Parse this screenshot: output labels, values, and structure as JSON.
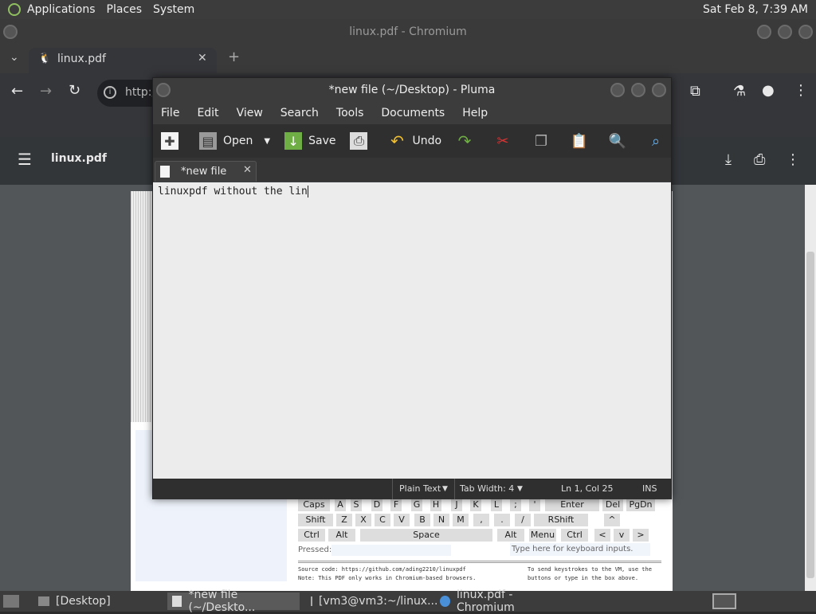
{
  "top_panel": {
    "menus": [
      "Applications",
      "Places",
      "System"
    ],
    "clock": "Sat Feb  8,  7:39 AM"
  },
  "chromium": {
    "window_title": "linux.pdf - Chromium",
    "tab_title": "linux.pdf",
    "address": "http:/",
    "pdf_title": "linux.pdf"
  },
  "pluma": {
    "title": "*new file (~/Desktop) - Pluma",
    "menu": [
      "File",
      "Edit",
      "View",
      "Search",
      "Tools",
      "Documents",
      "Help"
    ],
    "toolbar": {
      "open": "Open",
      "save": "Save",
      "undo": "Undo"
    },
    "tab_label": "*new file",
    "editor_text": "linuxpdf without the lin",
    "status": {
      "language": "Plain Text",
      "tab_width": "Tab Width:  4",
      "position": "Ln 1, Col 25",
      "mode": "INS"
    }
  },
  "pdf_page": {
    "keys_row1": [
      "Caps",
      "A",
      "S",
      "D",
      "F",
      "G",
      "H",
      "J",
      "K",
      "L",
      ";",
      "'",
      "Enter",
      "Del",
      "PgDn"
    ],
    "keys_row2": [
      "Shift",
      "Z",
      "X",
      "C",
      "V",
      "B",
      "N",
      "M",
      ",",
      ".",
      "/",
      "RShift",
      "^"
    ],
    "keys_row3": [
      "Ctrl",
      "Alt",
      "Space",
      "Alt",
      "Menu",
      "Ctrl",
      "<",
      "v",
      ">"
    ],
    "pressed_label": "Pressed:",
    "type_hint": "Type here for keyboard inputs.",
    "footer_left_1": "Source code: https://github.com/ading2210/linuxpdf",
    "footer_left_2": "Note: This PDF only works in Chromium-based browsers.",
    "footer_right_1": "To send keystrokes to the VM, use the",
    "footer_right_2": "buttons or type in the box above."
  },
  "taskbar": {
    "desktop": "[Desktop]",
    "pluma": "*new file (~/Deskto...",
    "terminal": "[vm3@vm3:~/linux...",
    "chromium": "linux.pdf - Chromium"
  }
}
